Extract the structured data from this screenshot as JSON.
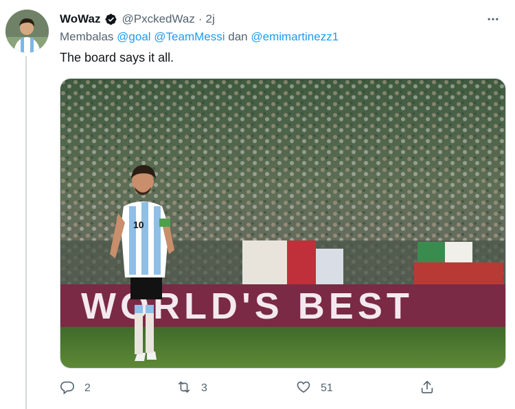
{
  "tweet": {
    "display_name": "WoWaz",
    "handle": "@PxckedWaz",
    "separator": "·",
    "time": "2j",
    "reply_prefix": "Membalas",
    "mentions": [
      "@goal",
      "@TeamMessi"
    ],
    "reply_conjunction": "dan",
    "last_mention": "@emimartinezz1",
    "text": "The board says it all.",
    "media": {
      "board_text": "WORLD'S BEST"
    },
    "actions": {
      "reply_count": "2",
      "retweet_count": "3",
      "like_count": "51"
    }
  },
  "icons": {
    "verified": "verified-badge-icon",
    "more": "more-icon",
    "reply": "reply-icon",
    "retweet": "retweet-icon",
    "like": "heart-icon",
    "share": "share-icon"
  },
  "colors": {
    "accent": "#1d9bf0",
    "secondary_text": "#536471",
    "board": "#7a2a44"
  }
}
